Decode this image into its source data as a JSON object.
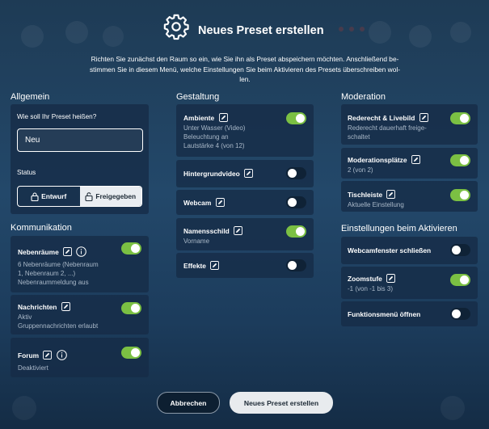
{
  "dialog": {
    "title": "Neues Preset erstellen",
    "intro_lines": [
      "Richten Sie zunächst den Raum so ein, wie Sie ihn als Preset abspeichern möchten. Anschließend be-",
      "stimmen Sie in diesem Menü, welche Einstellungen Sie beim Aktivieren des Presets überschreiben wol-",
      "len."
    ]
  },
  "allgemein": {
    "heading": "Allgemein",
    "name_question": "Wie soll Ihr Preset heißen?",
    "name_value": "Neu",
    "status_label": "Status",
    "status_options": [
      "Entwurf",
      "Freigegeben"
    ],
    "status_selected": "Freigegeben"
  },
  "kommunikation": {
    "heading": "Kommunikation",
    "items": [
      {
        "label": "Nebenräume",
        "details": [
          "6 Nebenräume (Nebenraum",
          "1, Nebenraum 2, ...)",
          "Nebenraummeldung aus"
        ],
        "on": true
      },
      {
        "label": "Nachrichten",
        "details": [
          "Aktiv",
          "Gruppennachrichten erlaubt"
        ],
        "on": true
      },
      {
        "label": "Forum",
        "details": [
          "Deaktiviert"
        ],
        "on": true
      }
    ]
  },
  "gestaltung": {
    "heading": "Gestaltung",
    "items": [
      {
        "label": "Ambiente",
        "details": [
          "Unter Wasser (Video)",
          "Beleuchtung an",
          "Lautstärke 4 (von 12)"
        ],
        "on": true
      },
      {
        "label": "Hintergrundvideo",
        "details": [],
        "on": false
      },
      {
        "label": "Webcam",
        "details": [],
        "on": false
      },
      {
        "label": "Namensschild",
        "details": [
          "Vorname"
        ],
        "on": true
      },
      {
        "label": "Effekte",
        "details": [],
        "on": false
      }
    ]
  },
  "moderation": {
    "heading": "Moderation",
    "items": [
      {
        "label": "Rederecht & Livebild",
        "details": [
          "Rederecht dauerhaft freige-",
          "schaltet"
        ],
        "on": true
      },
      {
        "label": "Moderationsplätze",
        "details": [
          "2 (von 2)"
        ],
        "on": true
      },
      {
        "label": "Tischleiste",
        "details": [
          "Aktuelle Einstellung"
        ],
        "on": true
      }
    ]
  },
  "aktivieren": {
    "heading": "Einstellungen beim Aktivieren",
    "items": [
      {
        "label": "Webcamfenster schließen",
        "details": [],
        "on": false
      },
      {
        "label": "Zoomstufe",
        "details": [
          "-1 (von -1 bis 3)"
        ],
        "on": true
      },
      {
        "label": "Funktionsmenü öffnen",
        "details": [],
        "on": false
      }
    ]
  },
  "footer": {
    "cancel_label": "Abbrechen",
    "create_label": "Neues Preset erstellen"
  },
  "colors": {
    "toggle_on": "#7bc043",
    "toggle_off": "#0f2236",
    "card": "#162c46"
  },
  "icons": [
    "gear-icon",
    "pencil-icon",
    "info-icon",
    "lock-icon",
    "unlock-icon"
  ]
}
